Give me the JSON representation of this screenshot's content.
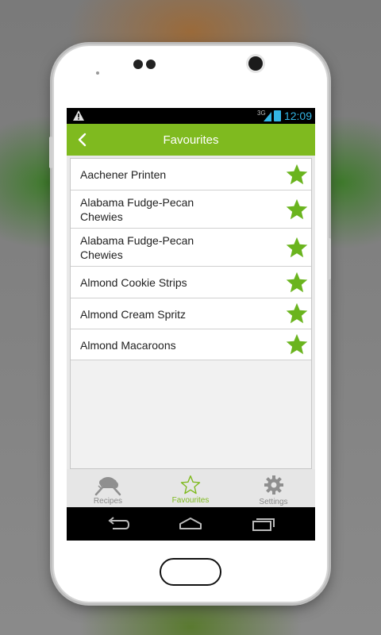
{
  "status_bar": {
    "network": "3G",
    "time": "12:09"
  },
  "app_bar": {
    "title": "Favourites"
  },
  "favourites": [
    {
      "label": "Aachener Printen"
    },
    {
      "label": "Alabama Fudge-Pecan Chewies"
    },
    {
      "label": "Alabama Fudge-Pecan Chewies"
    },
    {
      "label": "Almond Cookie Strips"
    },
    {
      "label": "Almond Cream Spritz"
    },
    {
      "label": "Almond Macaroons"
    }
  ],
  "bottom_nav": {
    "recipes": "Recipes",
    "favourites": "Favourites",
    "settings": "Settings",
    "active_tab": "favourites"
  },
  "colors": {
    "accent": "#7fba1f",
    "status_text": "#33b5e5",
    "star": "#6ab41e"
  },
  "icons": [
    "warning-icon",
    "signal-icon",
    "battery-icon",
    "back-arrow-icon",
    "star-icon",
    "chef-icon",
    "star-outline-icon",
    "gear-icon",
    "back-nav-icon",
    "home-nav-icon",
    "recents-nav-icon"
  ]
}
